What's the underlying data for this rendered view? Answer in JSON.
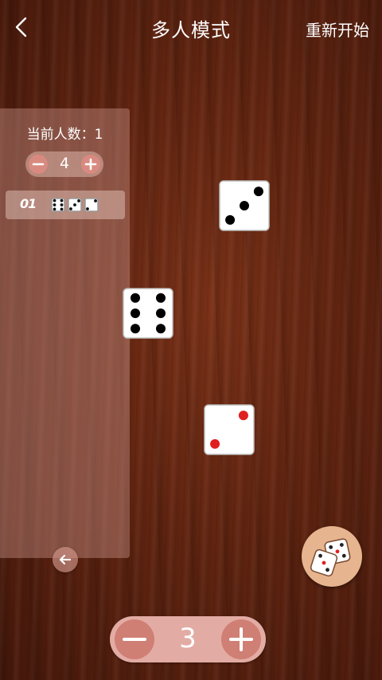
{
  "header": {
    "title": "多人模式",
    "restart_label": "重新开始",
    "back_icon": "chevron-left-icon"
  },
  "panel": {
    "players_label": "当前人数：1",
    "player_count": "4",
    "history": [
      {
        "index": "01",
        "dice": [
          6,
          3,
          2
        ]
      }
    ],
    "collapse_icon": "arrow-left-icon"
  },
  "table_dice": [
    {
      "value": 3,
      "pip_color": "#000000"
    },
    {
      "value": 6,
      "pip_color": "#000000"
    },
    {
      "value": 2,
      "pip_color": "#e02020"
    }
  ],
  "dice_count": {
    "value": "3",
    "minus_icon": "minus-icon",
    "plus_icon": "plus-icon"
  },
  "roll_button_icon": "dice-icon",
  "colors": {
    "panel_bg": "#cd968c",
    "stepper_bg": "#e2aca4",
    "stepper_btn": "#d07f74",
    "roll_button_bg": "#e6b58f",
    "red_pip": "#e02020"
  }
}
